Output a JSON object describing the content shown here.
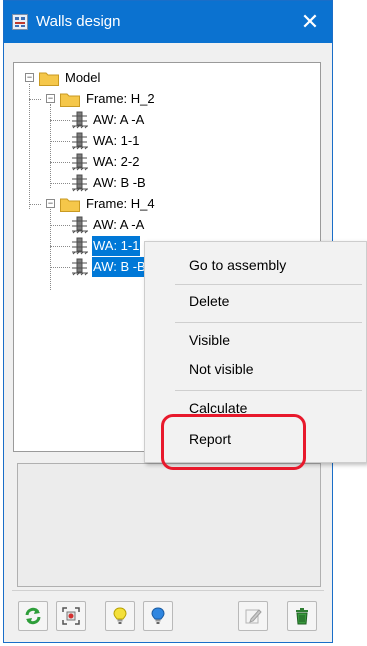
{
  "window": {
    "title": "Walls design",
    "close_glyph": "✕",
    "app_icon": "walls-app-icon"
  },
  "tree": {
    "root": {
      "label": "Model",
      "expander": "−"
    },
    "frames": [
      {
        "label": "Frame: H_2",
        "expander": "−",
        "walls": [
          {
            "label": "AW: A -A"
          },
          {
            "label": "WA: 1-1"
          },
          {
            "label": "WA: 2-2"
          },
          {
            "label": "AW: B -B"
          }
        ]
      },
      {
        "label": "Frame: H_4",
        "expander": "−",
        "walls": [
          {
            "label": "AW: A -A"
          },
          {
            "label": "WA: 1-1",
            "selected": true
          },
          {
            "label": "AW: B -B",
            "selected": true
          }
        ]
      }
    ]
  },
  "context_menu": {
    "items": [
      {
        "label": "Go to assembly"
      },
      {
        "label": "Delete"
      },
      {
        "label": "Visible"
      },
      {
        "label": "Not visible"
      },
      {
        "label": "Calculate"
      },
      {
        "label": "Report"
      }
    ]
  },
  "toolbar": {
    "buttons": [
      {
        "icon": "refresh-icon"
      },
      {
        "icon": "zoom-fit-icon"
      },
      {
        "icon": "yellow-bulb-icon"
      },
      {
        "icon": "blue-bulb-icon"
      },
      {
        "icon": "edit-icon"
      },
      {
        "icon": "trash-icon"
      }
    ]
  },
  "colors": {
    "titlebar": "#0b72d0",
    "selection": "#0078d7",
    "highlight_ring": "#e8192c",
    "folder": "#f5c74a"
  }
}
